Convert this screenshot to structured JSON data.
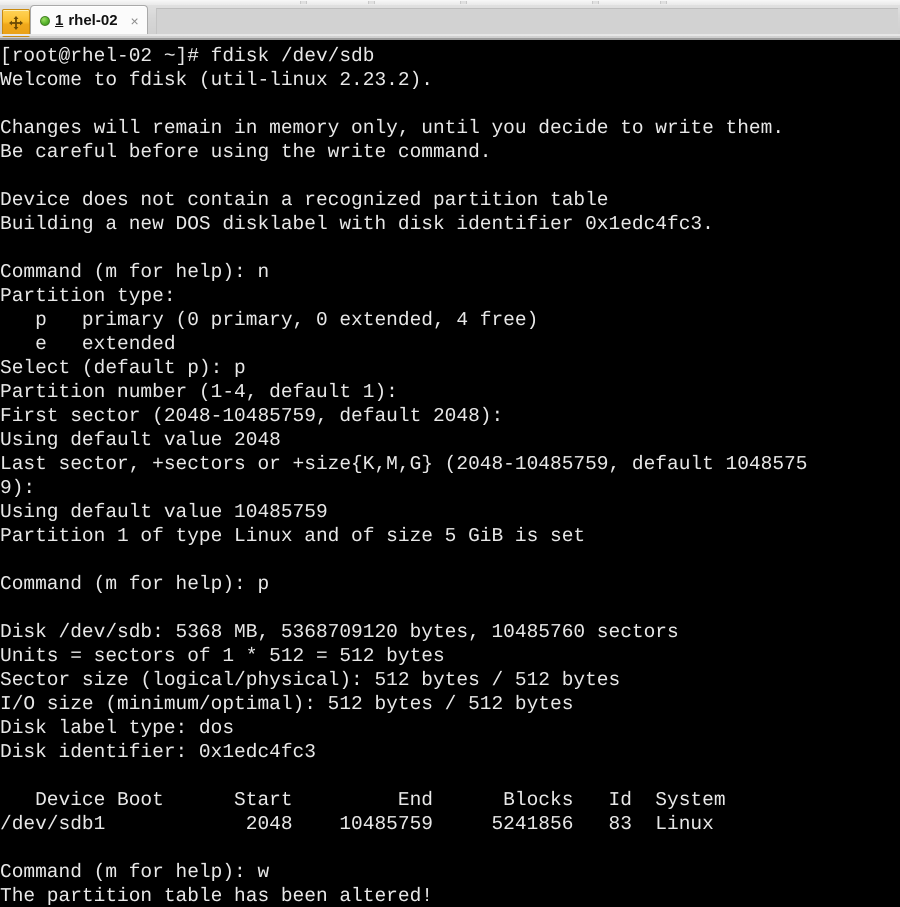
{
  "window": {
    "app_icon_name": "move-arrows-icon",
    "tab": {
      "index_label": "1",
      "title": "rhel-02",
      "close_label": "×",
      "status": "connected"
    }
  },
  "terminal": {
    "prompt_host": "[root@rhel-02 ~]#",
    "command": "fdisk /dev/sdb",
    "foreground_color": "#e8e8e8",
    "background_color": "#000000",
    "lines": [
      "[root@rhel-02 ~]# fdisk /dev/sdb",
      "Welcome to fdisk (util-linux 2.23.2).",
      "",
      "Changes will remain in memory only, until you decide to write them.",
      "Be careful before using the write command.",
      "",
      "Device does not contain a recognized partition table",
      "Building a new DOS disklabel with disk identifier 0x1edc4fc3.",
      "",
      "Command (m for help): n",
      "Partition type:",
      "   p   primary (0 primary, 0 extended, 4 free)",
      "   e   extended",
      "Select (default p): p",
      "Partition number (1-4, default 1):",
      "First sector (2048-10485759, default 2048):",
      "Using default value 2048",
      "Last sector, +sectors or +size{K,M,G} (2048-10485759, default 1048575",
      "9):",
      "Using default value 10485759",
      "Partition 1 of type Linux and of size 5 GiB is set",
      "",
      "Command (m for help): p",
      "",
      "Disk /dev/sdb: 5368 MB, 5368709120 bytes, 10485760 sectors",
      "Units = sectors of 1 * 512 = 512 bytes",
      "Sector size (logical/physical): 512 bytes / 512 bytes",
      "I/O size (minimum/optimal): 512 bytes / 512 bytes",
      "Disk label type: dos",
      "Disk identifier: 0x1edc4fc3",
      "",
      "   Device Boot      Start         End      Blocks   Id  System",
      "/dev/sdb1            2048    10485759     5241856   83  Linux",
      "",
      "Command (m for help): w",
      "The partition table has been altered!"
    ],
    "disk_info": {
      "device": "/dev/sdb",
      "size_mb": "5368 MB",
      "size_bytes": "5368709120 bytes",
      "sectors": "10485760 sectors",
      "units": "sectors of 1 * 512 = 512 bytes",
      "sector_size_logical": "512 bytes",
      "sector_size_physical": "512 bytes",
      "io_size_minimum": "512 bytes",
      "io_size_optimal": "512 bytes",
      "disk_label_type": "dos",
      "disk_identifier": "0x1edc4fc3",
      "util_linux_version": "2.23.2"
    },
    "partition_table": {
      "headers": [
        "Device",
        "Boot",
        "Start",
        "End",
        "Blocks",
        "Id",
        "System"
      ],
      "rows": [
        {
          "device": "/dev/sdb1",
          "boot": "",
          "start": "2048",
          "end": "10485759",
          "blocks": "5241856",
          "id": "83",
          "system": "Linux"
        }
      ]
    },
    "fdisk_answers": {
      "new_partition": "n",
      "partition_type": "p",
      "partition_number": "",
      "first_sector": "",
      "last_sector": "",
      "print_table": "p",
      "write": "w"
    }
  }
}
